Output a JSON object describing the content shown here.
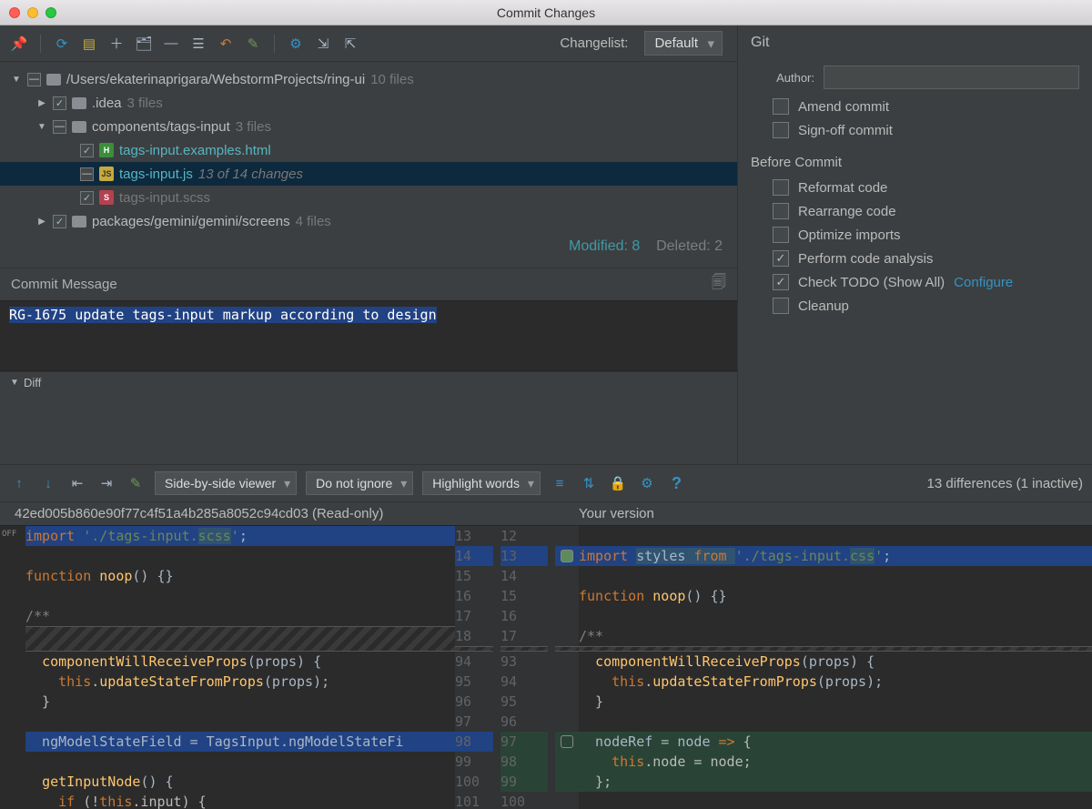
{
  "window": {
    "title": "Commit Changes"
  },
  "toolbar": {
    "changelist_label": "Changelist:",
    "changelist_value": "Default"
  },
  "tree": {
    "root": {
      "path": "/Users/ekaterinaprigara/WebstormProjects/ring-ui",
      "count": "10 files"
    },
    "idea": {
      "name": ".idea",
      "count": "3 files"
    },
    "tags_folder": {
      "name": "components/tags-input",
      "count": "3 files"
    },
    "files": {
      "examples": {
        "name": "tags-input.examples.html"
      },
      "js": {
        "name": "tags-input.js",
        "meta": "13 of 14 changes"
      },
      "scss": {
        "name": "tags-input.scss"
      }
    },
    "gemini": {
      "name": "packages/gemini/gemini/screens",
      "count": "4 files"
    },
    "stats": {
      "modified": "Modified: 8",
      "deleted": "Deleted: 2"
    }
  },
  "commit": {
    "header": "Commit Message",
    "message": "RG-1675 update tags-input markup according to design"
  },
  "diff": {
    "header": "Diff",
    "viewer": "Side-by-side viewer",
    "ignore": "Do not ignore",
    "highlight": "Highlight words",
    "count": "13 differences (1 inactive)",
    "left_title": "42ed005b860e90f77c4f51a4b285a8052c94cd03 (Read-only)",
    "right_title": "Your version",
    "off": "OFF"
  },
  "git": {
    "header": "Git",
    "author_label": "Author:",
    "amend": "Amend commit",
    "signoff": "Sign-off commit",
    "before": "Before Commit",
    "reformat": "Reformat code",
    "rearrange": "Rearrange code",
    "optimize": "Optimize imports",
    "analysis": "Perform code analysis",
    "todo": "Check TODO (Show All)",
    "configure": "Configure",
    "cleanup": "Cleanup"
  },
  "code": {
    "left": {
      "lines_top": [
        "13",
        "14",
        "15",
        "16",
        "17",
        "18"
      ],
      "lines_bot": [
        "94",
        "95",
        "96",
        "97",
        "98",
        "99",
        "100",
        "101"
      ],
      "l14_a": "import ",
      "l14_b": "'./tags-input.",
      "l14_c": "scss",
      "l14_d": "'",
      "l14_e": ";",
      "l16_a": "function ",
      "l16_b": "noop",
      "l16_c": "() {}",
      "l18": "/**",
      "b1": "  componentWillReceiveProps(props) {",
      "b1_a": "  ",
      "b1_b": "componentWillReceiveProps",
      "b1_c": "(props) {",
      "b2_a": "    ",
      "b2_b": "this",
      "b2_c": ".",
      "b2_d": "updateStateFromProps",
      "b2_e": "(props);",
      "b3": "  }",
      "b5_a": "  ngModelStateField = TagsInput.ngModelStateFi",
      "b7": "  getInputNode() {",
      "b7_a": "  ",
      "b7_b": "getInputNode",
      "b7_c": "() {",
      "b8_a": "    ",
      "b8_b": "if ",
      "b8_c": "(!",
      "b8_d": "this",
      "b8_e": ".input) {"
    },
    "right": {
      "lines_top": [
        "12",
        "13",
        "14",
        "15",
        "16",
        "17"
      ],
      "lines_bot": [
        "93",
        "94",
        "95",
        "96",
        "97",
        "98",
        "99",
        "100"
      ],
      "l13_a": "import ",
      "l13_b": "styles ",
      "l13_c": "from ",
      "l13_d": "'./tags-input.",
      "l13_e": "css",
      "l13_f": "'",
      "l13_g": ";",
      "l15_a": "function ",
      "l15_b": "noop",
      "l15_c": "() {}",
      "l17": "/**",
      "b1_a": "  ",
      "b1_b": "componentWillReceiveProps",
      "b1_c": "(props) {",
      "b2_a": "    ",
      "b2_b": "this",
      "b2_c": ".",
      "b2_d": "updateStateFromProps",
      "b2_e": "(props);",
      "b3": "  }",
      "b5_a": "  nodeRef = node ",
      "b5_b": "=> ",
      "b5_c": "{",
      "b6_a": "    ",
      "b6_b": "this",
      "b6_c": ".node = node;",
      "b7": "  };"
    }
  }
}
